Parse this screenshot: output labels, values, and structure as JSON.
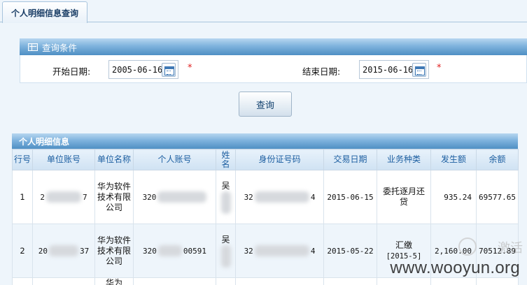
{
  "tab": {
    "label": "个人明细信息查询"
  },
  "query_panel": {
    "title": "查询条件",
    "start_label": "开始日期:",
    "start_value": "2005-06-16",
    "end_label": "结束日期:",
    "end_value": "2015-06-16",
    "required_mark": "*",
    "query_button": "查询"
  },
  "detail": {
    "title": "个人明细信息",
    "columns": [
      "行号",
      "单位账号",
      "单位名称",
      "个人账号",
      "姓名",
      "身份证号码",
      "交易日期",
      "业务种类",
      "发生额",
      "余额"
    ],
    "rows": [
      {
        "row_no": "1",
        "unit_account_start": "2",
        "unit_account_end": "7",
        "unit_name": "华为软件技术有限公司",
        "personal_account_start": "320",
        "name": "吴",
        "id_start": "32",
        "id_end": "4",
        "date": "2015-06-15",
        "business": "委托逐月还贷",
        "amount": "935.24",
        "balance": "69577.65"
      },
      {
        "row_no": "2",
        "unit_account_start": "20",
        "unit_account_end": "37",
        "unit_name": "华为软件技术有限公司",
        "personal_account_start": "320",
        "personal_account_end": "00591",
        "name": "吴",
        "id_start": "32",
        "id_end": "4",
        "date": "2015-05-22",
        "business": "汇缴",
        "business_sub": "[2015-5]",
        "amount": "2,160.00",
        "balance": "70512.89"
      },
      {
        "unit_name": "华为"
      }
    ]
  },
  "watermark": {
    "text": "www.wooyun.org",
    "cn": "激活"
  }
}
